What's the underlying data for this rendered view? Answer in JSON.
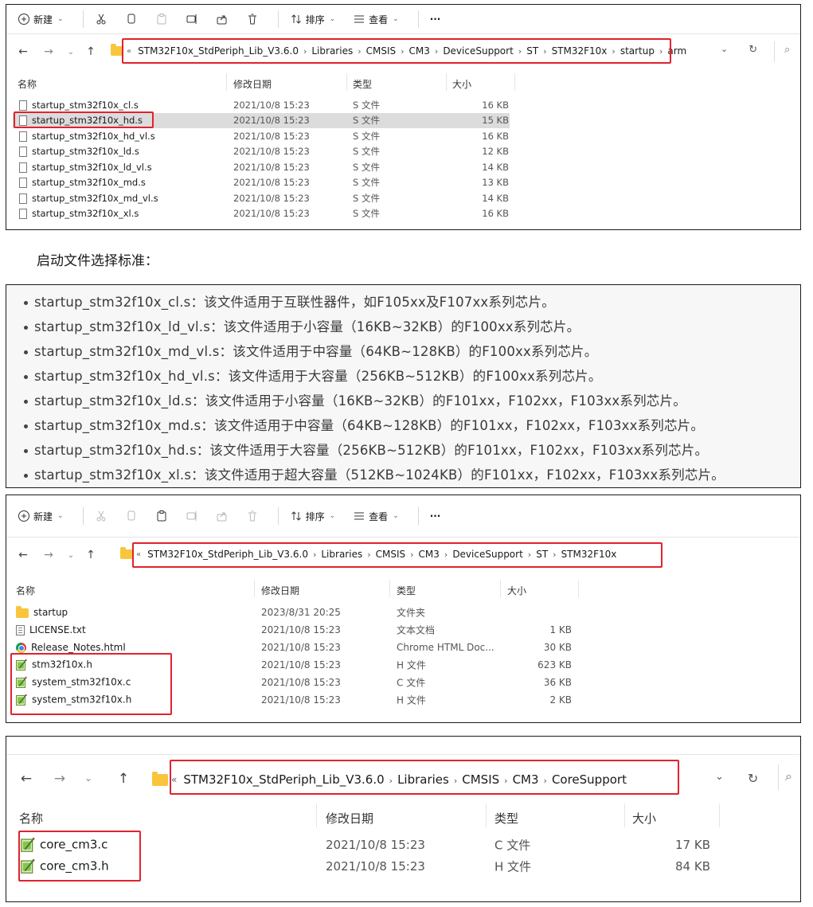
{
  "toolbar": {
    "new_label": "新建",
    "sort_label": "排序",
    "view_label": "查看",
    "more_label": "···"
  },
  "panel1": {
    "breadcrumb": [
      "STM32F10x_StdPeriph_Lib_V3.6.0",
      "Libraries",
      "CMSIS",
      "CM3",
      "DeviceSupport",
      "ST",
      "STM32F10x",
      "startup",
      "arm"
    ],
    "overflow": "«",
    "columns": {
      "name": "名称",
      "date": "修改日期",
      "type": "类型",
      "size": "大小"
    },
    "files": [
      {
        "name": "startup_stm32f10x_cl.s",
        "date": "2021/10/8 15:23",
        "type": "S 文件",
        "size": "16 KB"
      },
      {
        "name": "startup_stm32f10x_hd.s",
        "date": "2021/10/8 15:23",
        "type": "S 文件",
        "size": "15 KB",
        "selected": true
      },
      {
        "name": "startup_stm32f10x_hd_vl.s",
        "date": "2021/10/8 15:23",
        "type": "S 文件",
        "size": "16 KB"
      },
      {
        "name": "startup_stm32f10x_ld.s",
        "date": "2021/10/8 15:23",
        "type": "S 文件",
        "size": "12 KB"
      },
      {
        "name": "startup_stm32f10x_ld_vl.s",
        "date": "2021/10/8 15:23",
        "type": "S 文件",
        "size": "14 KB"
      },
      {
        "name": "startup_stm32f10x_md.s",
        "date": "2021/10/8 15:23",
        "type": "S 文件",
        "size": "13 KB"
      },
      {
        "name": "startup_stm32f10x_md_vl.s",
        "date": "2021/10/8 15:23",
        "type": "S 文件",
        "size": "14 KB"
      },
      {
        "name": "startup_stm32f10x_xl.s",
        "date": "2021/10/8 15:23",
        "type": "S 文件",
        "size": "16 KB"
      }
    ]
  },
  "caption": "启动文件选择标准：",
  "criteria": [
    "startup_stm32f10x_cl.s：该文件适用于互联性器件，如F105xx及F107xx系列芯片。",
    "startup_stm32f10x_ld_vl.s：该文件适用于小容量（16KB~32KB）的F100xx系列芯片。",
    "startup_stm32f10x_md_vl.s：该文件适用于中容量（64KB~128KB）的F100xx系列芯片。",
    "startup_stm32f10x_hd_vl.s：该文件适用于大容量（256KB~512KB）的F100xx系列芯片。",
    "startup_stm32f10x_ld.s：该文件适用于小容量（16KB~32KB）的F101xx，F102xx，F103xx系列芯片。",
    "startup_stm32f10x_md.s：该文件适用于中容量（64KB~128KB）的F101xx，F102xx，F103xx系列芯片。",
    "startup_stm32f10x_hd.s：该文件适用于大容量（256KB~512KB）的F101xx，F102xx，F103xx系列芯片。",
    "startup_stm32f10x_xl.s：该文件适用于超大容量（512KB~1024KB）的F101xx，F102xx，F103xx系列芯片。"
  ],
  "panel2": {
    "breadcrumb": [
      "STM32F10x_StdPeriph_Lib_V3.6.0",
      "Libraries",
      "CMSIS",
      "CM3",
      "DeviceSupport",
      "ST",
      "STM32F10x"
    ],
    "overflow": "«",
    "columns": {
      "name": "名称",
      "date": "修改日期",
      "type": "类型",
      "size": "大小"
    },
    "files": [
      {
        "name": "startup",
        "date": "2023/8/31 20:25",
        "type": "文件夹",
        "size": "",
        "icon": "folder-icon"
      },
      {
        "name": "LICENSE.txt",
        "date": "2021/10/8 15:23",
        "type": "文本文档",
        "size": "1 KB",
        "icon": "text-file-icon"
      },
      {
        "name": "Release_Notes.html",
        "date": "2021/10/8 15:23",
        "type": "Chrome HTML Doc...",
        "size": "30 KB",
        "icon": "chrome-icon"
      },
      {
        "name": "stm32f10x.h",
        "date": "2021/10/8 15:23",
        "type": "H 文件",
        "size": "623 KB",
        "icon": "source-file-icon"
      },
      {
        "name": "system_stm32f10x.c",
        "date": "2021/10/8 15:23",
        "type": "C 文件",
        "size": "36 KB",
        "icon": "source-file-icon"
      },
      {
        "name": "system_stm32f10x.h",
        "date": "2021/10/8 15:23",
        "type": "H 文件",
        "size": "2 KB",
        "icon": "source-file-icon"
      }
    ]
  },
  "panel3": {
    "breadcrumb": [
      "STM32F10x_StdPeriph_Lib_V3.6.0",
      "Libraries",
      "CMSIS",
      "CM3",
      "CoreSupport"
    ],
    "overflow": "«",
    "columns": {
      "name": "名称",
      "date": "修改日期",
      "type": "类型",
      "size": "大小"
    },
    "files": [
      {
        "name": "core_cm3.c",
        "date": "2021/10/8 15:23",
        "type": "C 文件",
        "size": "17 KB",
        "icon": "source-file-icon"
      },
      {
        "name": "core_cm3.h",
        "date": "2021/10/8 15:23",
        "type": "H 文件",
        "size": "84 KB",
        "icon": "source-file-icon"
      }
    ]
  },
  "colors": {
    "highlight": "#e0232e",
    "selected_row": "#dcdcdc",
    "folder": "#f8c53d"
  }
}
